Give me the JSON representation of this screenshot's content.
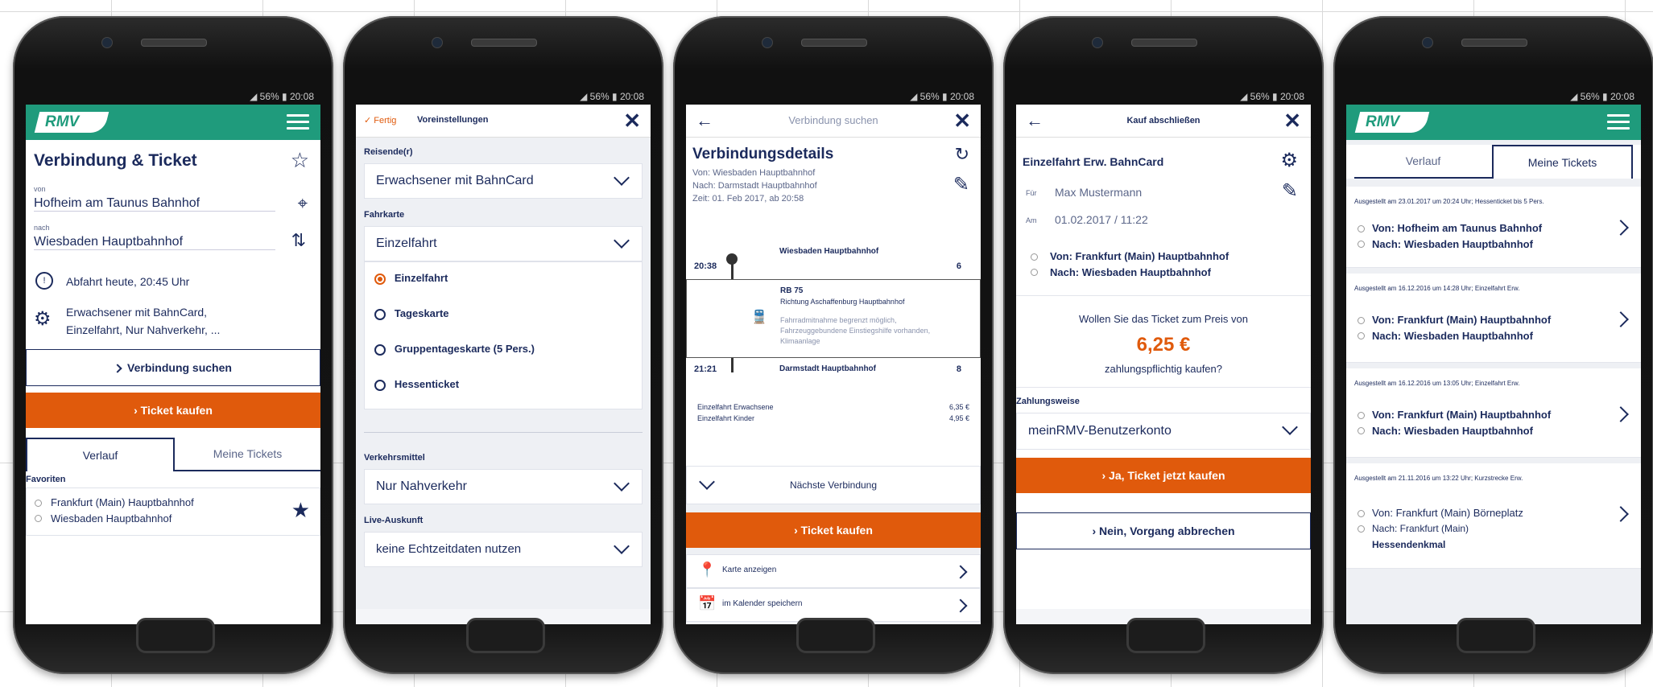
{
  "status": {
    "text": "◢ 56% ▮ 20:08"
  },
  "brand": {
    "logo": "RMV"
  },
  "phone1": {
    "title": "Verbindung & Ticket",
    "from_label": "von",
    "from": "Hofheim am Taunus Bahnhof",
    "to_label": "nach",
    "to": "Wiesbaden Hauptbahnhof",
    "departure": "Abfahrt heute, 20:45 Uhr",
    "settings_line1": "Erwachsener mit BahnCard,",
    "settings_line2": "Einzelfahrt, Nur Nahverkehr, ...",
    "search_btn": "Verbindung suchen",
    "buy_btn": "Ticket kaufen",
    "tab_history": "Verlauf",
    "tab_tickets": "Meine Tickets",
    "favorites_label": "Favoriten",
    "fav_from": "Frankfurt (Main) Hauptbahnhof",
    "fav_to": "Wiesbaden Hauptbahnhof"
  },
  "phone2": {
    "done": "✓ Fertig",
    "title": "Voreinstellungen",
    "travelers_label": "Reisende(r)",
    "travelers": "Erwachsener mit BahnCard",
    "fare_label": "Fahrkarte",
    "fare": "Einzelfahrt",
    "options": [
      "Einzelfahrt",
      "Tageskarte",
      "Gruppentageskarte (5 Pers.)",
      "Hessenticket"
    ],
    "transport_label": "Verkehrsmittel",
    "transport": "Nur Nahverkehr",
    "live_label": "Live-Auskunft",
    "live": "keine Echtzeitdaten nutzen"
  },
  "phone3": {
    "header": "Verbindung suchen",
    "title": "Verbindungsdetails",
    "from": "Von: Wiesbaden Hauptbahnhof",
    "to": "Nach: Darmstadt Hauptbahnhof",
    "time": "Zeit: 01. Feb 2017, ab 20:58",
    "dep_time": "20:38",
    "dep_station": "Wiesbaden Hauptbahnhof",
    "dep_track": "6",
    "train": "RB 75",
    "direction": "Richtung Aschaffenburg Hauptbahnhof",
    "note": "Fahrradmitnahme begrenzt möglich, Fahrzeuggebundene Einstiegshilfe vorhanden, Klimaanlage",
    "arr_time": "21:21",
    "arr_station": "Darmstadt Hauptbahnhof",
    "arr_track": "8",
    "price1_label": "Einzelfahrt Erwachsene",
    "price1": "6,35 €",
    "price2_label": "Einzelfahrt Kinder",
    "price2": "4,95 €",
    "next": "Nächste Verbindung",
    "buy_btn": "Ticket kaufen",
    "map": "Karte anzeigen",
    "calendar": "im Kalender speichern"
  },
  "phone4": {
    "header": "Kauf abschließen",
    "ticket": "Einzelfahrt Erw. BahnCard",
    "for_label": "Für",
    "for": "Max Mustermann",
    "on_label": "Am",
    "on": "01.02.2017 / 11:22",
    "from": "Von: Frankfurt (Main) Hauptbahnhof",
    "to": "Nach: Wiesbaden Hauptbahnhof",
    "question": "Wollen Sie das Ticket zum Preis von",
    "price": "6,25 €",
    "question2": "zahlungspflichtig kaufen?",
    "payment_label": "Zahlungsweise",
    "payment": "meinRMV-Benutzerkonto",
    "confirm_btn": "Ja, Ticket jetzt kaufen",
    "cancel_btn": "Nein, Vorgang abbrechen"
  },
  "phone5": {
    "tab_history": "Verlauf",
    "tab_tickets": "Meine Tickets",
    "tickets": [
      {
        "meta": "Ausgestellt am 23.01.2017 um 20:24 Uhr; Hessenticket bis 5 Pers.",
        "from": "Von: Hofheim am Taunus Bahnhof",
        "to": "Nach: Wiesbaden Hauptbahnhof",
        "extra": ""
      },
      {
        "meta": "Ausgestellt am 16.12.2016 um 14:28 Uhr; Einzelfahrt Erw.",
        "from": "Von: Frankfurt (Main) Hauptbahnhof",
        "to": "Nach: Wiesbaden Hauptbahnhof",
        "extra": ""
      },
      {
        "meta": "Ausgestellt am 16.12.2016 um 13:05 Uhr; Einzelfahrt Erw.",
        "from": "Von: Frankfurt (Main) Hauptbahnhof",
        "to": "Nach: Wiesbaden Hauptbahnhof",
        "extra": ""
      },
      {
        "meta": "Ausgestellt am 21.11.2016 um 13:22 Uhr; Kurzstrecke Erw.",
        "from": "Von: Frankfurt (Main) Börneplatz",
        "to": "Nach: Frankfurt (Main)",
        "extra": "Hessendenkmal"
      }
    ]
  }
}
